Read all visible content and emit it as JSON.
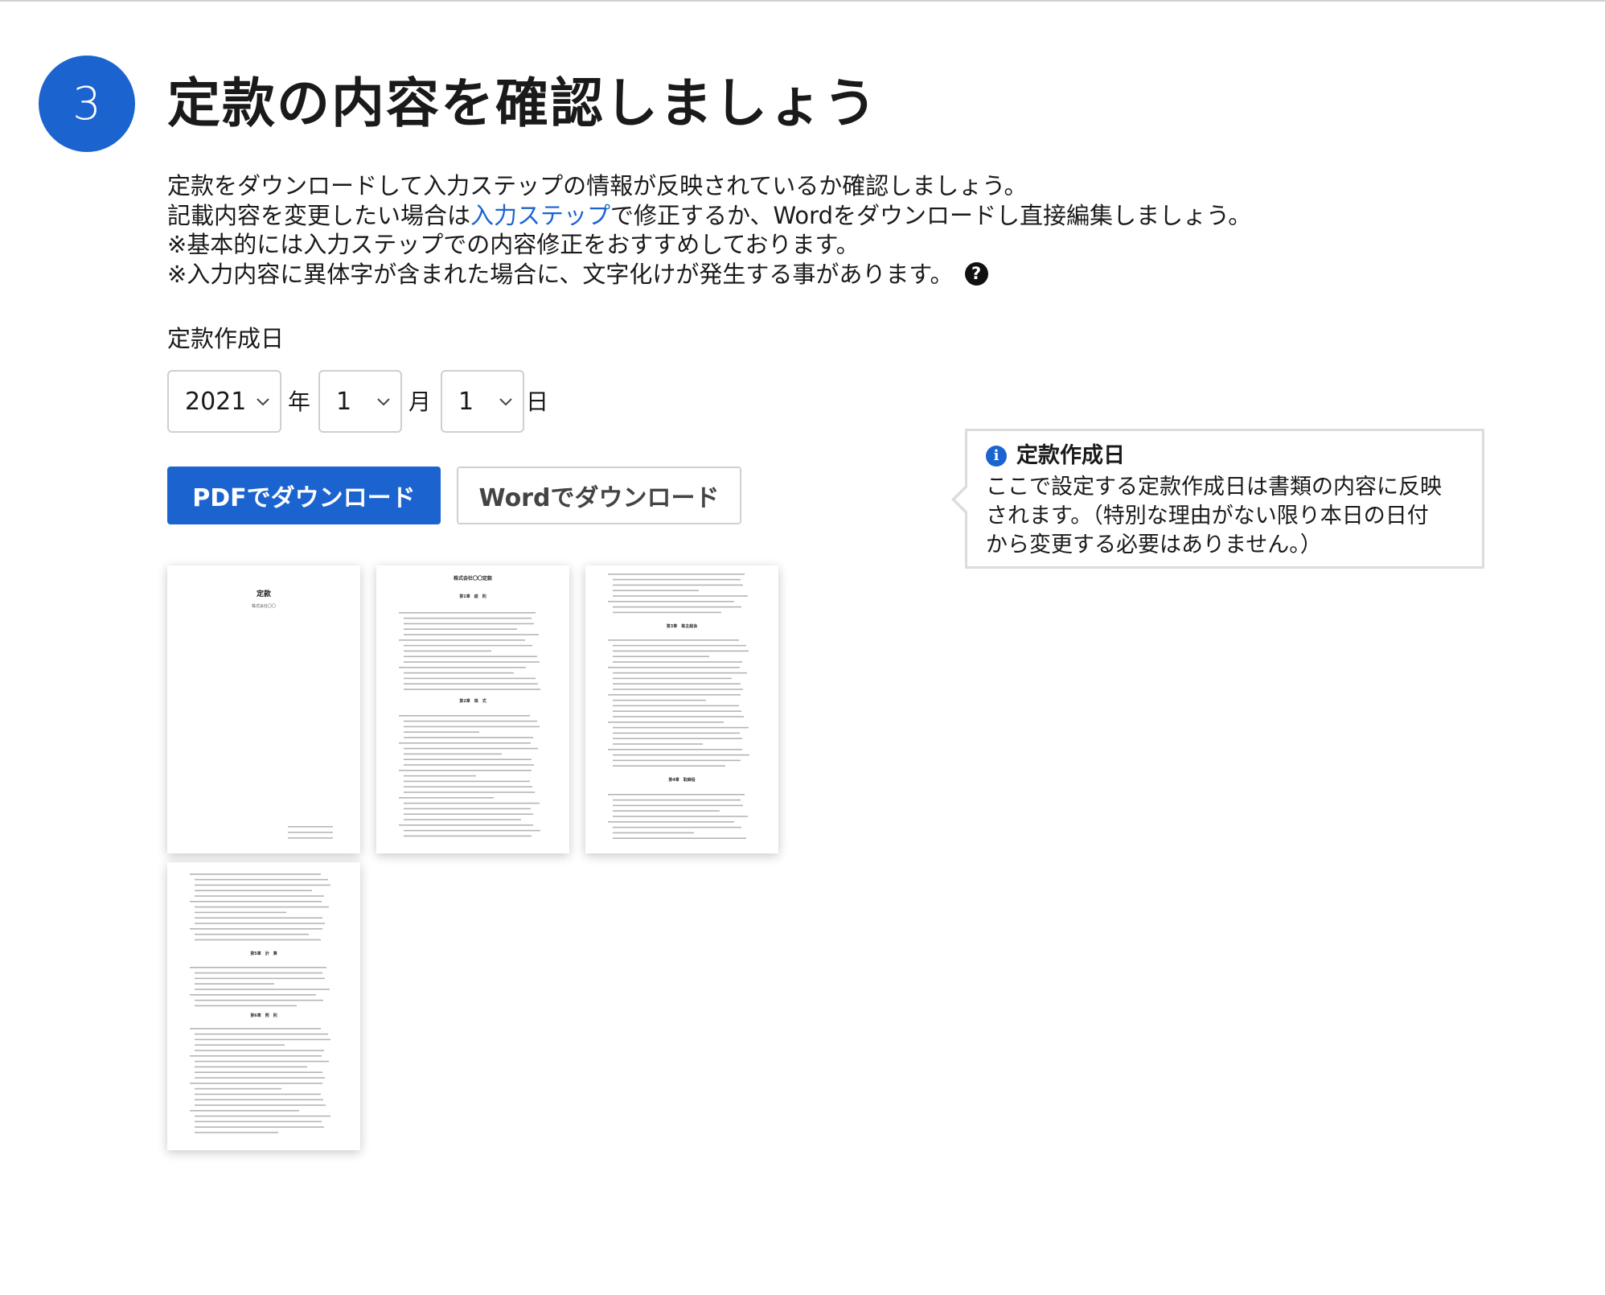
{
  "step": {
    "number": "3",
    "title": "定款の内容を確認しましょう"
  },
  "description": {
    "line1": "定款をダウンロードして入力ステップの情報が反映されているか確認しましょう。",
    "line2_before": "記載内容を変更したい場合は",
    "line2_link": "入力ステップ",
    "line2_after": "で修正するか、Wordをダウンロードし直接編集しましょう。",
    "line3": "※基本的には入力ステップでの内容修正をおすすめしております。",
    "line4": "※入力内容に異体字が含まれた場合に、文字化けが発生する事があります。",
    "help_icon": "question-circle-icon",
    "help_glyph": "?"
  },
  "date": {
    "label": "定款作成日",
    "year": {
      "value": "2021",
      "unit": "年"
    },
    "month": {
      "value": "1",
      "unit": "月"
    },
    "day": {
      "value": "1",
      "unit": "日"
    }
  },
  "buttons": {
    "pdf": "PDFでダウンロード",
    "word": "Wordでダウンロード"
  },
  "tooltip": {
    "icon": "info-icon",
    "icon_glyph": "i",
    "title": "定款作成日",
    "line1": "ここで設定する定款作成日は書類の内容に反映",
    "line2": "されます。（特別な理由がない限り本日の日付",
    "line3": "から変更する必要はありません。）"
  },
  "preview": {
    "page1_title": "定款",
    "page1_subtitle": "株式会社〇〇",
    "page2_title": "株式会社〇〇定款",
    "chapters": [
      "第1章　総　則",
      "第2章　株　式",
      "第3章　株主総会",
      "第4章　取締役",
      "第5章　計　算",
      "第6章　附　則"
    ]
  },
  "colors": {
    "primary": "#1b64d0",
    "border": "#cfcfcf",
    "text": "#1a1a1a"
  }
}
